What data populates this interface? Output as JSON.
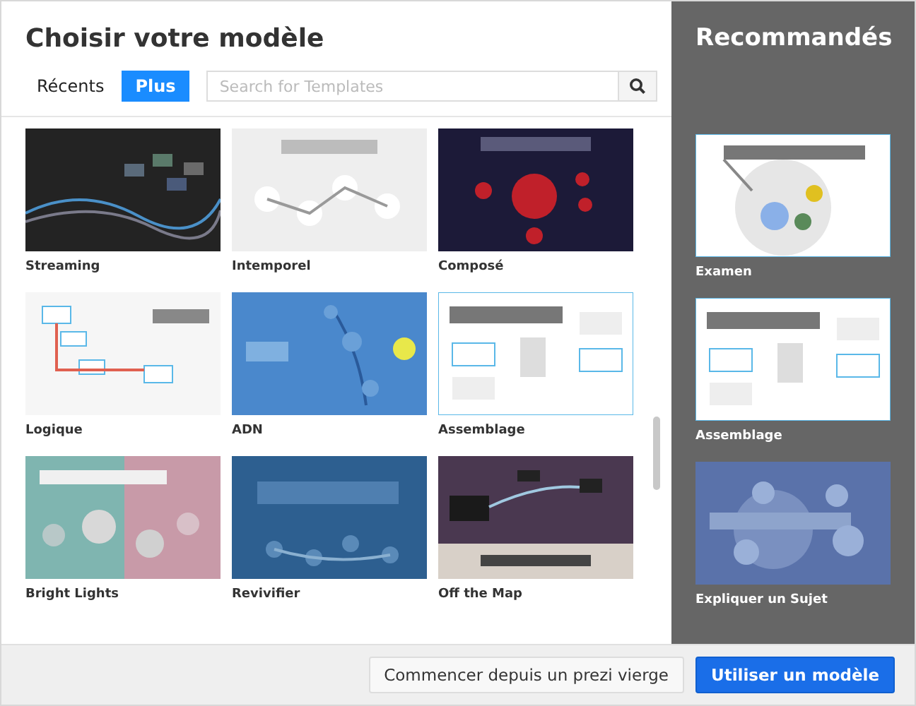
{
  "dialog": {
    "title": "Choisir votre modèle"
  },
  "tabs": [
    {
      "label": "Récents",
      "selected": false
    },
    {
      "label": "Plus",
      "selected": true
    }
  ],
  "search": {
    "placeholder": "Search for Templates"
  },
  "templates": [
    {
      "name": "Streaming",
      "kind": "picture"
    },
    {
      "name": "Intemporel",
      "kind": "picture"
    },
    {
      "name": "Composé",
      "kind": "picture"
    },
    {
      "name": "Logique",
      "kind": "picture"
    },
    {
      "name": "ADN",
      "kind": "picture"
    },
    {
      "name": "Assemblage",
      "kind": "picture"
    },
    {
      "name": "Bright Lights",
      "kind": "picture"
    },
    {
      "name": "Revivifier",
      "kind": "picture"
    },
    {
      "name": "Off the Map",
      "kind": "picture"
    }
  ],
  "recommended": {
    "title": "Recommandés",
    "items": [
      {
        "name": "Examen",
        "kind": "picture"
      },
      {
        "name": "Assemblage",
        "kind": "picture"
      },
      {
        "name": "Expliquer un Sujet",
        "kind": "picture"
      }
    ]
  },
  "footer": {
    "buttons": [
      {
        "label": "Commencer depuis un prezi vierge",
        "kind": "secondary"
      },
      {
        "label": "Utiliser un modèle",
        "kind": "primary"
      }
    ]
  }
}
